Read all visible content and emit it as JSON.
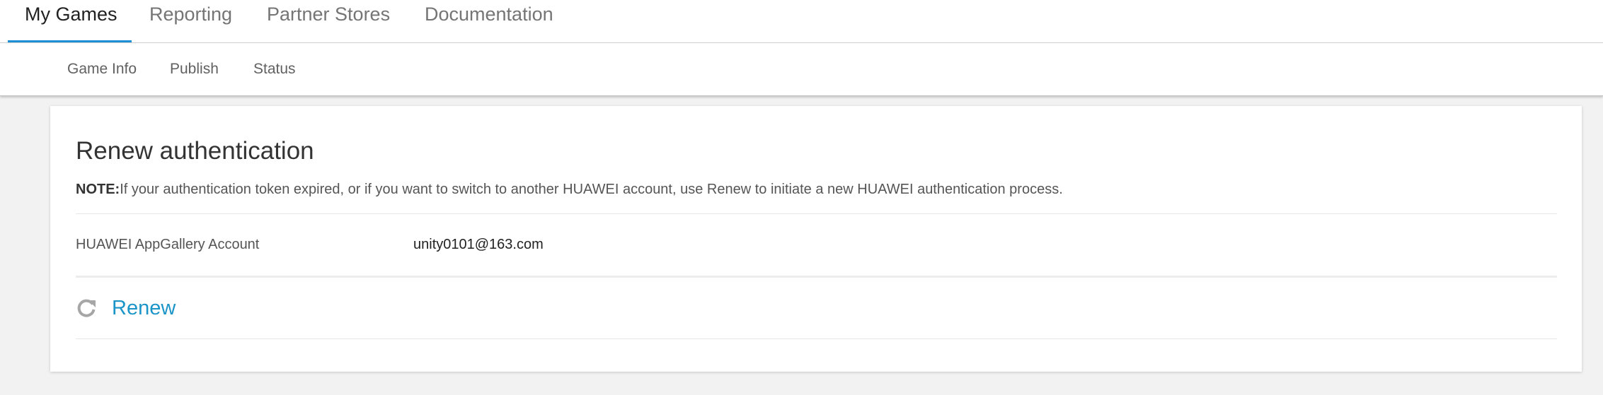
{
  "top_nav": {
    "tabs": [
      {
        "label": "My Games",
        "active": true
      },
      {
        "label": "Reporting",
        "active": false
      },
      {
        "label": "Partner Stores",
        "active": false
      },
      {
        "label": "Documentation",
        "active": false
      }
    ]
  },
  "sub_nav": {
    "tabs": [
      {
        "label": "Game Info"
      },
      {
        "label": "Publish"
      },
      {
        "label": "Status"
      }
    ]
  },
  "card": {
    "title": "Renew authentication",
    "note_prefix": "NOTE:",
    "note_text": "If your authentication token expired, or if you want to switch to another HUAWEI account, use Renew to initiate a new HUAWEI authentication process.",
    "account_label": "HUAWEI AppGallery Account",
    "account_value": "unity0101@163.com",
    "renew_label": "Renew",
    "renew_icon": "refresh-icon"
  },
  "colors": {
    "accent": "#1c8fd6",
    "renew": "#1b95c8",
    "background": "#f2f2f2"
  }
}
